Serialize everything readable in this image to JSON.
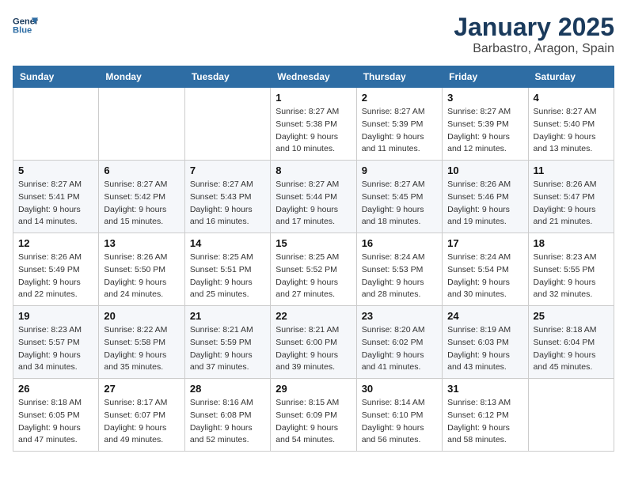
{
  "header": {
    "logo_line1": "General",
    "logo_line2": "Blue",
    "month": "January 2025",
    "location": "Barbastro, Aragon, Spain"
  },
  "weekdays": [
    "Sunday",
    "Monday",
    "Tuesday",
    "Wednesday",
    "Thursday",
    "Friday",
    "Saturday"
  ],
  "weeks": [
    [
      {
        "day": "",
        "info": ""
      },
      {
        "day": "",
        "info": ""
      },
      {
        "day": "",
        "info": ""
      },
      {
        "day": "1",
        "info": "Sunrise: 8:27 AM\nSunset: 5:38 PM\nDaylight: 9 hours\nand 10 minutes."
      },
      {
        "day": "2",
        "info": "Sunrise: 8:27 AM\nSunset: 5:39 PM\nDaylight: 9 hours\nand 11 minutes."
      },
      {
        "day": "3",
        "info": "Sunrise: 8:27 AM\nSunset: 5:39 PM\nDaylight: 9 hours\nand 12 minutes."
      },
      {
        "day": "4",
        "info": "Sunrise: 8:27 AM\nSunset: 5:40 PM\nDaylight: 9 hours\nand 13 minutes."
      }
    ],
    [
      {
        "day": "5",
        "info": "Sunrise: 8:27 AM\nSunset: 5:41 PM\nDaylight: 9 hours\nand 14 minutes."
      },
      {
        "day": "6",
        "info": "Sunrise: 8:27 AM\nSunset: 5:42 PM\nDaylight: 9 hours\nand 15 minutes."
      },
      {
        "day": "7",
        "info": "Sunrise: 8:27 AM\nSunset: 5:43 PM\nDaylight: 9 hours\nand 16 minutes."
      },
      {
        "day": "8",
        "info": "Sunrise: 8:27 AM\nSunset: 5:44 PM\nDaylight: 9 hours\nand 17 minutes."
      },
      {
        "day": "9",
        "info": "Sunrise: 8:27 AM\nSunset: 5:45 PM\nDaylight: 9 hours\nand 18 minutes."
      },
      {
        "day": "10",
        "info": "Sunrise: 8:26 AM\nSunset: 5:46 PM\nDaylight: 9 hours\nand 19 minutes."
      },
      {
        "day": "11",
        "info": "Sunrise: 8:26 AM\nSunset: 5:47 PM\nDaylight: 9 hours\nand 21 minutes."
      }
    ],
    [
      {
        "day": "12",
        "info": "Sunrise: 8:26 AM\nSunset: 5:49 PM\nDaylight: 9 hours\nand 22 minutes."
      },
      {
        "day": "13",
        "info": "Sunrise: 8:26 AM\nSunset: 5:50 PM\nDaylight: 9 hours\nand 24 minutes."
      },
      {
        "day": "14",
        "info": "Sunrise: 8:25 AM\nSunset: 5:51 PM\nDaylight: 9 hours\nand 25 minutes."
      },
      {
        "day": "15",
        "info": "Sunrise: 8:25 AM\nSunset: 5:52 PM\nDaylight: 9 hours\nand 27 minutes."
      },
      {
        "day": "16",
        "info": "Sunrise: 8:24 AM\nSunset: 5:53 PM\nDaylight: 9 hours\nand 28 minutes."
      },
      {
        "day": "17",
        "info": "Sunrise: 8:24 AM\nSunset: 5:54 PM\nDaylight: 9 hours\nand 30 minutes."
      },
      {
        "day": "18",
        "info": "Sunrise: 8:23 AM\nSunset: 5:55 PM\nDaylight: 9 hours\nand 32 minutes."
      }
    ],
    [
      {
        "day": "19",
        "info": "Sunrise: 8:23 AM\nSunset: 5:57 PM\nDaylight: 9 hours\nand 34 minutes."
      },
      {
        "day": "20",
        "info": "Sunrise: 8:22 AM\nSunset: 5:58 PM\nDaylight: 9 hours\nand 35 minutes."
      },
      {
        "day": "21",
        "info": "Sunrise: 8:21 AM\nSunset: 5:59 PM\nDaylight: 9 hours\nand 37 minutes."
      },
      {
        "day": "22",
        "info": "Sunrise: 8:21 AM\nSunset: 6:00 PM\nDaylight: 9 hours\nand 39 minutes."
      },
      {
        "day": "23",
        "info": "Sunrise: 8:20 AM\nSunset: 6:02 PM\nDaylight: 9 hours\nand 41 minutes."
      },
      {
        "day": "24",
        "info": "Sunrise: 8:19 AM\nSunset: 6:03 PM\nDaylight: 9 hours\nand 43 minutes."
      },
      {
        "day": "25",
        "info": "Sunrise: 8:18 AM\nSunset: 6:04 PM\nDaylight: 9 hours\nand 45 minutes."
      }
    ],
    [
      {
        "day": "26",
        "info": "Sunrise: 8:18 AM\nSunset: 6:05 PM\nDaylight: 9 hours\nand 47 minutes."
      },
      {
        "day": "27",
        "info": "Sunrise: 8:17 AM\nSunset: 6:07 PM\nDaylight: 9 hours\nand 49 minutes."
      },
      {
        "day": "28",
        "info": "Sunrise: 8:16 AM\nSunset: 6:08 PM\nDaylight: 9 hours\nand 52 minutes."
      },
      {
        "day": "29",
        "info": "Sunrise: 8:15 AM\nSunset: 6:09 PM\nDaylight: 9 hours\nand 54 minutes."
      },
      {
        "day": "30",
        "info": "Sunrise: 8:14 AM\nSunset: 6:10 PM\nDaylight: 9 hours\nand 56 minutes."
      },
      {
        "day": "31",
        "info": "Sunrise: 8:13 AM\nSunset: 6:12 PM\nDaylight: 9 hours\nand 58 minutes."
      },
      {
        "day": "",
        "info": ""
      }
    ]
  ]
}
